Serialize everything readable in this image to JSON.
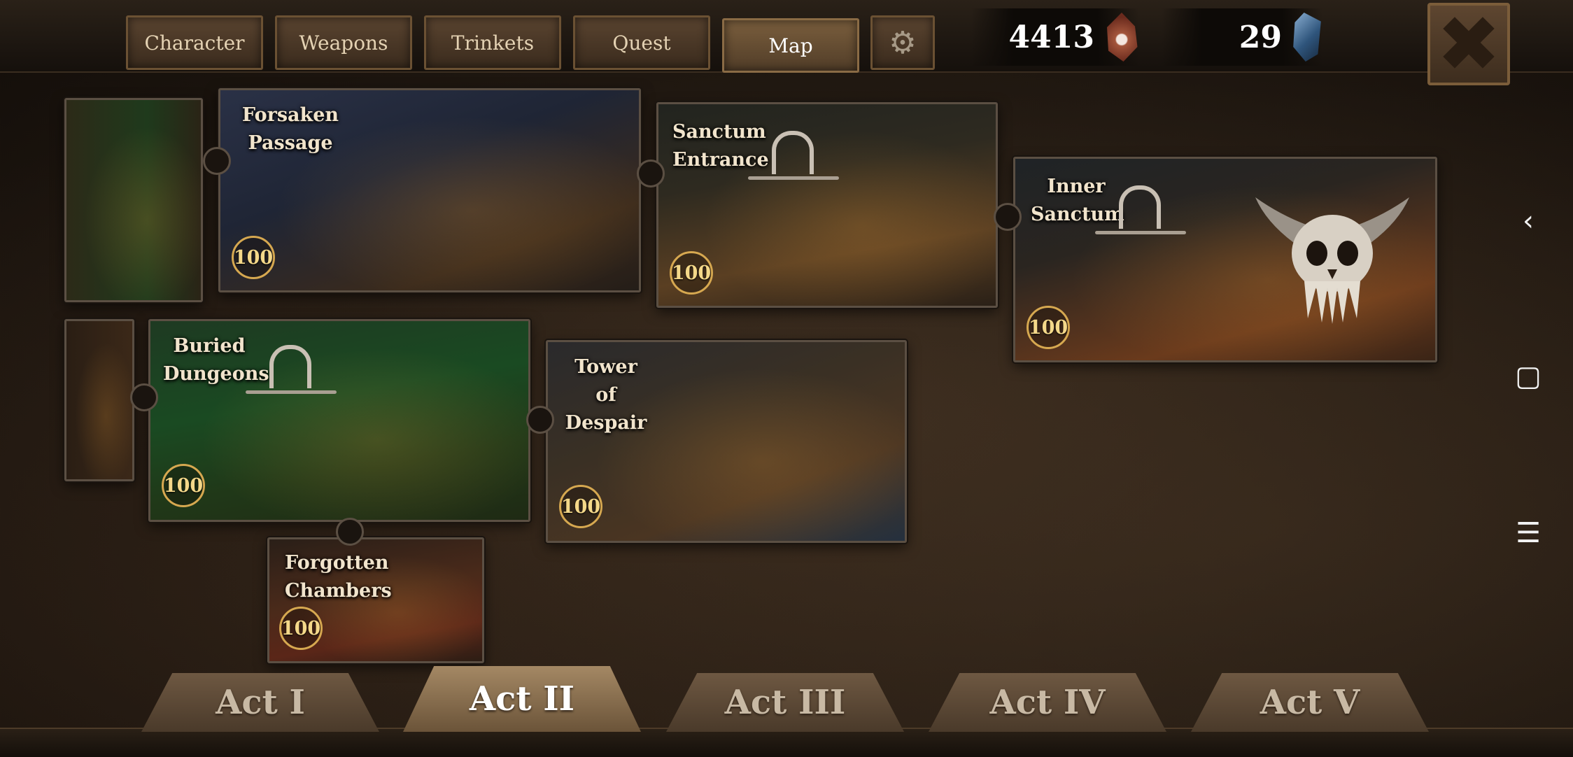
{
  "tabs": {
    "character": "Character",
    "weapons": "Weapons",
    "trinkets": "Trinkets",
    "quest": "Quest",
    "map": "Map"
  },
  "currency": {
    "souls": "4413",
    "crystals": "29"
  },
  "levels": [
    {
      "title_line1": "Forsaken",
      "title_line2": "Passage",
      "score": "100"
    },
    {
      "title_line1": "Sanctum",
      "title_line2": "Entrance",
      "score": "100"
    },
    {
      "title_line1": "Inner",
      "title_line2": "Sanctum",
      "score": "100"
    },
    {
      "title_line1": "Buried",
      "title_line2": "Dungeons",
      "score": "100"
    },
    {
      "title_line1": "Tower of",
      "title_line2": "Despair",
      "score": "100"
    },
    {
      "title_line1": "Forgotten",
      "title_line2": "Chambers",
      "score": "100"
    }
  ],
  "acts": [
    "Act I",
    "Act II",
    "Act III",
    "Act IV",
    "Act V"
  ],
  "active_act": "Act II",
  "icons": {
    "settings": "gear-icon",
    "close": "close-icon",
    "souls": "red-soul-gem-icon",
    "crystals": "blue-crystal-icon"
  }
}
